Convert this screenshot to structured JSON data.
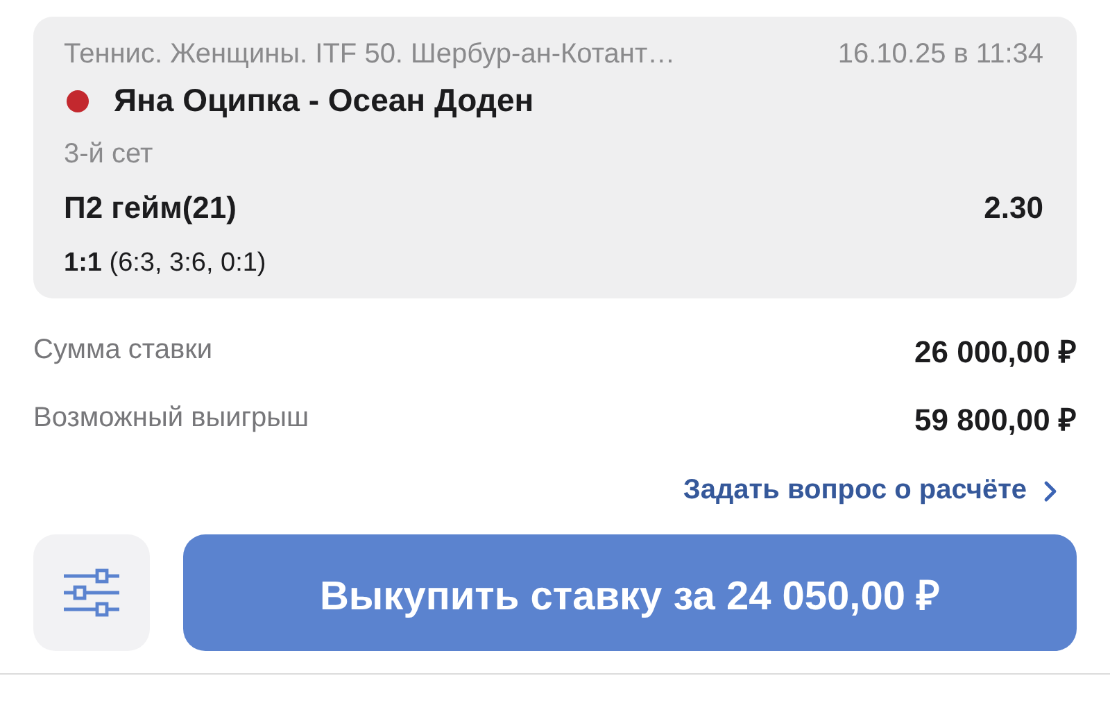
{
  "event": {
    "tournament": "Теннис. Женщины. ITF 50. Шербур-ан-Котант…",
    "datetime": "16.10.25 в 11:34",
    "live": true,
    "match": "Яна Оципка - Осеан Доден",
    "period": "3-й сет",
    "market": "П2 гейм(21)",
    "odds": "2.30",
    "score": "**1:1** (6:3, 3:6, 0:1)"
  },
  "summary": [
    {
      "label": "Сумма ставки",
      "value": "26 000,00 ₽"
    },
    {
      "label": "Возможный выигрыш",
      "value": "59 800,00 ₽"
    }
  ],
  "question_link": "Задать вопрос о расчёте",
  "cashout_button": "Выкупить ставку за 24 050,00 ₽"
}
